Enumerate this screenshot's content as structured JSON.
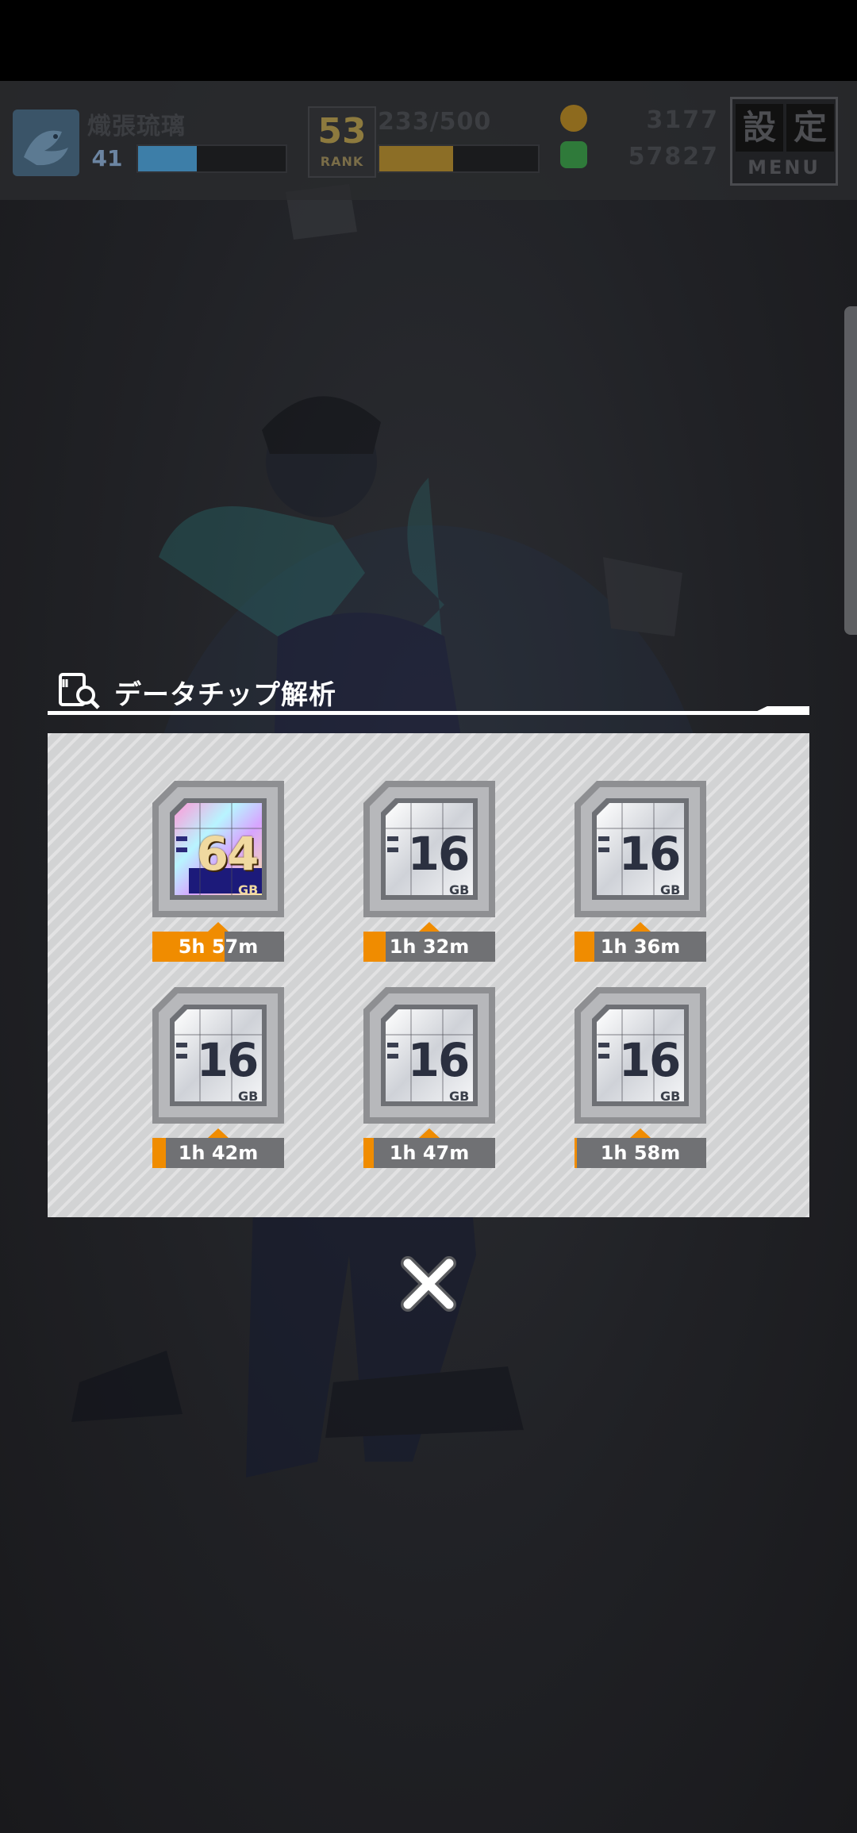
{
  "hud": {
    "player": {
      "name": "熾張琉璃",
      "level": "41",
      "exp_fraction": 0.4
    },
    "rank": {
      "value": "53",
      "label": "RANK",
      "stamina": "233/500",
      "stamina_fraction": 0.466
    },
    "currency": [
      {
        "icon": "coin-icon",
        "value": "3177",
        "color": "#8d6a1e"
      },
      {
        "icon": "gem-icon",
        "value": "57827",
        "color": "#2f7a3a"
      }
    ],
    "menu": {
      "kanji_1": "設",
      "kanji_2": "定",
      "label": "MENU"
    }
  },
  "dialog": {
    "title": "データチップ解析",
    "chips": [
      {
        "capacity": "64",
        "unit": "GB",
        "tier": "gold",
        "timer": "5h 57m",
        "progress": 0.55
      },
      {
        "capacity": "16",
        "unit": "GB",
        "tier": "silver",
        "timer": "1h 32m",
        "progress": 0.17
      },
      {
        "capacity": "16",
        "unit": "GB",
        "tier": "silver",
        "timer": "1h 36m",
        "progress": 0.15
      },
      {
        "capacity": "16",
        "unit": "GB",
        "tier": "silver",
        "timer": "1h 42m",
        "progress": 0.1
      },
      {
        "capacity": "16",
        "unit": "GB",
        "tier": "silver",
        "timer": "1h 47m",
        "progress": 0.08
      },
      {
        "capacity": "16",
        "unit": "GB",
        "tier": "silver",
        "timer": "1h 58m",
        "progress": 0.01
      }
    ],
    "close_icon": "close-icon"
  },
  "colors": {
    "accent": "#f08c00",
    "panel": "#d2d3d4",
    "overlay": "#1e1f22"
  }
}
